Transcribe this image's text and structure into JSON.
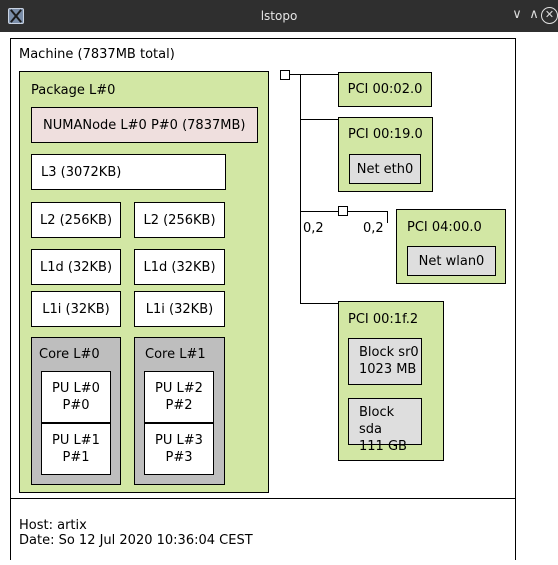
{
  "window": {
    "title": "lstopo",
    "min_glyph": "∨",
    "max_glyph": "∧",
    "close_glyph": "✕"
  },
  "machine": {
    "label": "Machine (7837MB total)"
  },
  "package": {
    "label": "Package L#0",
    "numa": "NUMANode L#0 P#0 (7837MB)",
    "l3": "L3 (3072KB)",
    "l2": [
      "L2 (256KB)",
      "L2 (256KB)"
    ],
    "l1d": [
      "L1d (32KB)",
      "L1d (32KB)"
    ],
    "l1i": [
      "L1i (32KB)",
      "L1i (32KB)"
    ],
    "cores": [
      {
        "label": "Core L#0",
        "pus": [
          {
            "line1": "PU L#0",
            "line2": "P#0"
          },
          {
            "line1": "PU L#1",
            "line2": "P#1"
          }
        ]
      },
      {
        "label": "Core L#1",
        "pus": [
          {
            "line1": "PU L#2",
            "line2": "P#2"
          },
          {
            "line1": "PU L#3",
            "line2": "P#3"
          }
        ]
      }
    ]
  },
  "pci": {
    "dev1": "PCI 00:02.0",
    "dev2": {
      "label": "PCI 00:19.0",
      "net": "Net eth0"
    },
    "bridge_left": "0,2",
    "bridge_right": "0,2",
    "dev3": {
      "label": "PCI 04:00.0",
      "net": "Net wlan0"
    },
    "dev4": {
      "label": "PCI 00:1f.2",
      "blocks": [
        {
          "line1": "Block sr0",
          "line2": "1023 MB"
        },
        {
          "line1": "Block sda",
          "line2": "111 GB"
        }
      ]
    }
  },
  "footer": {
    "host": "Host: artix",
    "date": "Date: So 12 Jul 2020 10:36:04 CEST"
  }
}
